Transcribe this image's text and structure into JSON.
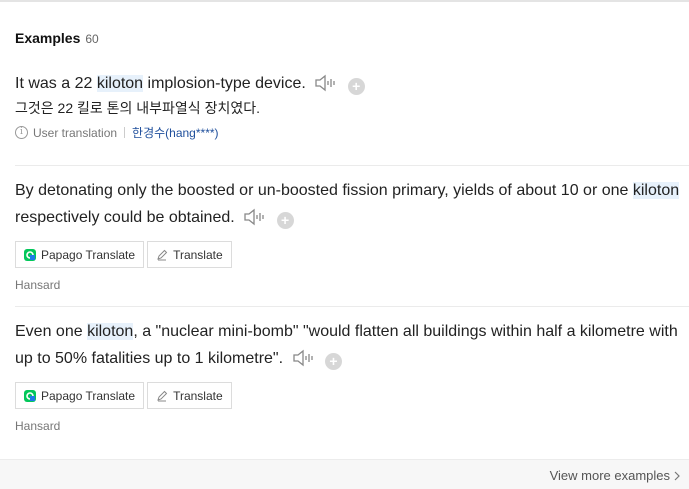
{
  "header": {
    "title": "Examples",
    "count": "60"
  },
  "examples": [
    {
      "parts": [
        "It was a 22 ",
        "kiloton",
        " implosion-type device."
      ],
      "translation": "그것은 22 킬로 톤의 내부파열식 장치였다.",
      "meta": {
        "label": "User translation",
        "user": "한경수(hang****)"
      }
    },
    {
      "parts": [
        "By detonating only the boosted or un-boosted fission primary, yields of about 10 or one ",
        "kiloton",
        " respectively could be obtained."
      ],
      "buttons": {
        "papago": "Papago Translate",
        "translate": "Translate"
      },
      "source": "Hansard"
    },
    {
      "parts": [
        "Even one ",
        "kiloton",
        ", a \"nuclear mini-bomb\" \"would flatten all buildings within half a kilometre with up to 50% fatalities up to 1 kilometre\"."
      ],
      "buttons": {
        "papago": "Papago Translate",
        "translate": "Translate"
      },
      "source": "Hansard"
    }
  ],
  "footer": {
    "more": "View more examples"
  },
  "icons": {
    "audio": "speaker-icon",
    "add": "plus-circle-icon",
    "info": "info-icon",
    "papago": "papago-logo-icon",
    "pencil": "pencil-icon",
    "chevron": "chevron-right-icon"
  },
  "colors": {
    "highlight": "#e7f1fb",
    "user_link": "#1f4f9c",
    "papago_green": "#03c75a"
  }
}
